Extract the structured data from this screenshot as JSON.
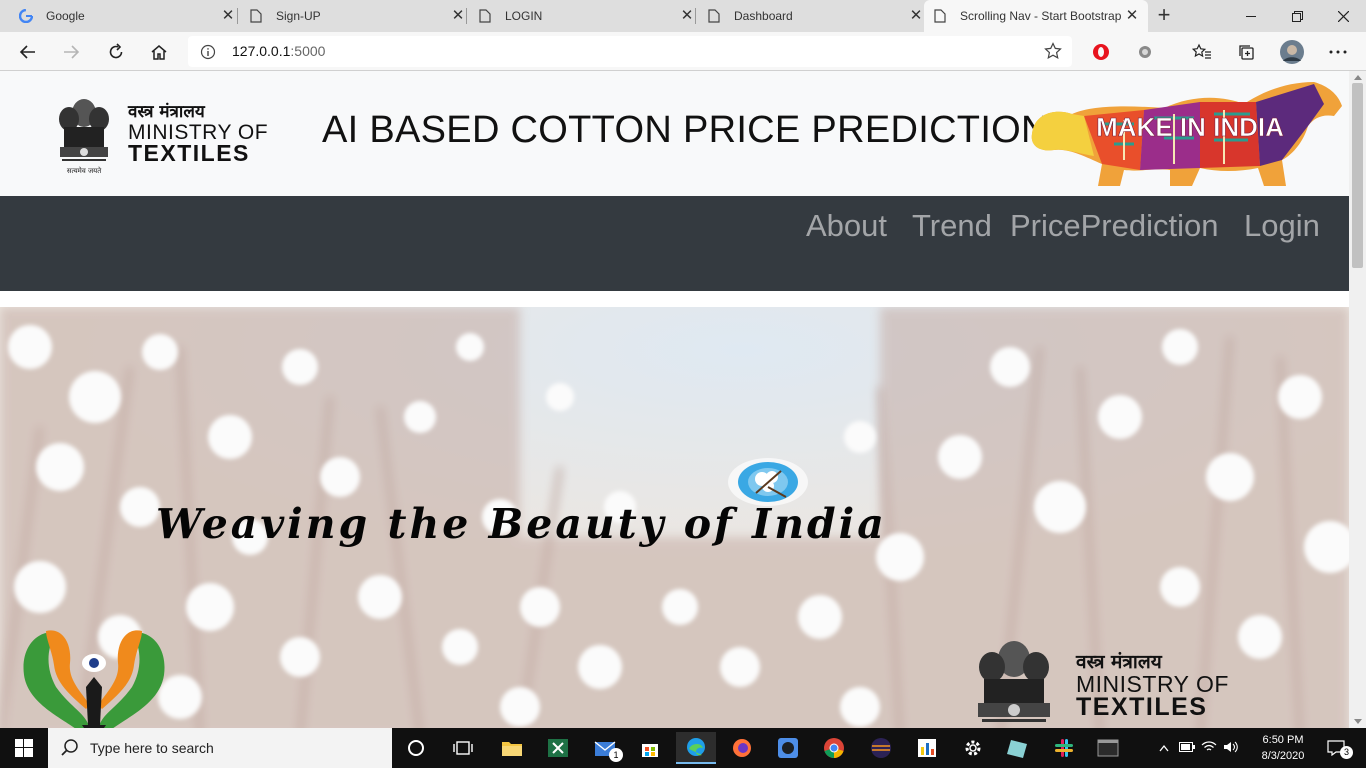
{
  "browser": {
    "tabs": [
      {
        "title": "Google",
        "icon": "google-icon",
        "active": false
      },
      {
        "title": "Sign-UP",
        "icon": "page-icon",
        "active": false
      },
      {
        "title": "LOGIN",
        "icon": "page-icon",
        "active": false
      },
      {
        "title": "Dashboard",
        "icon": "page-icon",
        "active": false
      },
      {
        "title": "Scrolling Nav - Start Bootstrap",
        "icon": "page-icon",
        "active": true
      }
    ],
    "address": {
      "host": "127.0.0.1",
      "port": ":5000"
    }
  },
  "site": {
    "ministry": {
      "hindi": "वस्त्र मंत्रालय",
      "line1": "MINISTRY OF",
      "line2": "TEXTILES",
      "motto": "सत्यमेव जयते"
    },
    "title": "AI BASED COTTON PRICE PREDICTION",
    "make_in_india": "MAKE IN INDIA",
    "nav": [
      "About",
      "Trend",
      "PricePrediction",
      "Login"
    ],
    "hero": {
      "tagline": "Weaving the Beauty of India"
    },
    "colors": {
      "navbar": "#343a40",
      "header": "#f8f9fa",
      "nav_text": "#a3a5a8"
    }
  },
  "taskbar": {
    "search_placeholder": "Type here to search",
    "mail_badge": "1",
    "time": "6:50 PM",
    "date": "8/3/2020",
    "notifications": "3"
  }
}
